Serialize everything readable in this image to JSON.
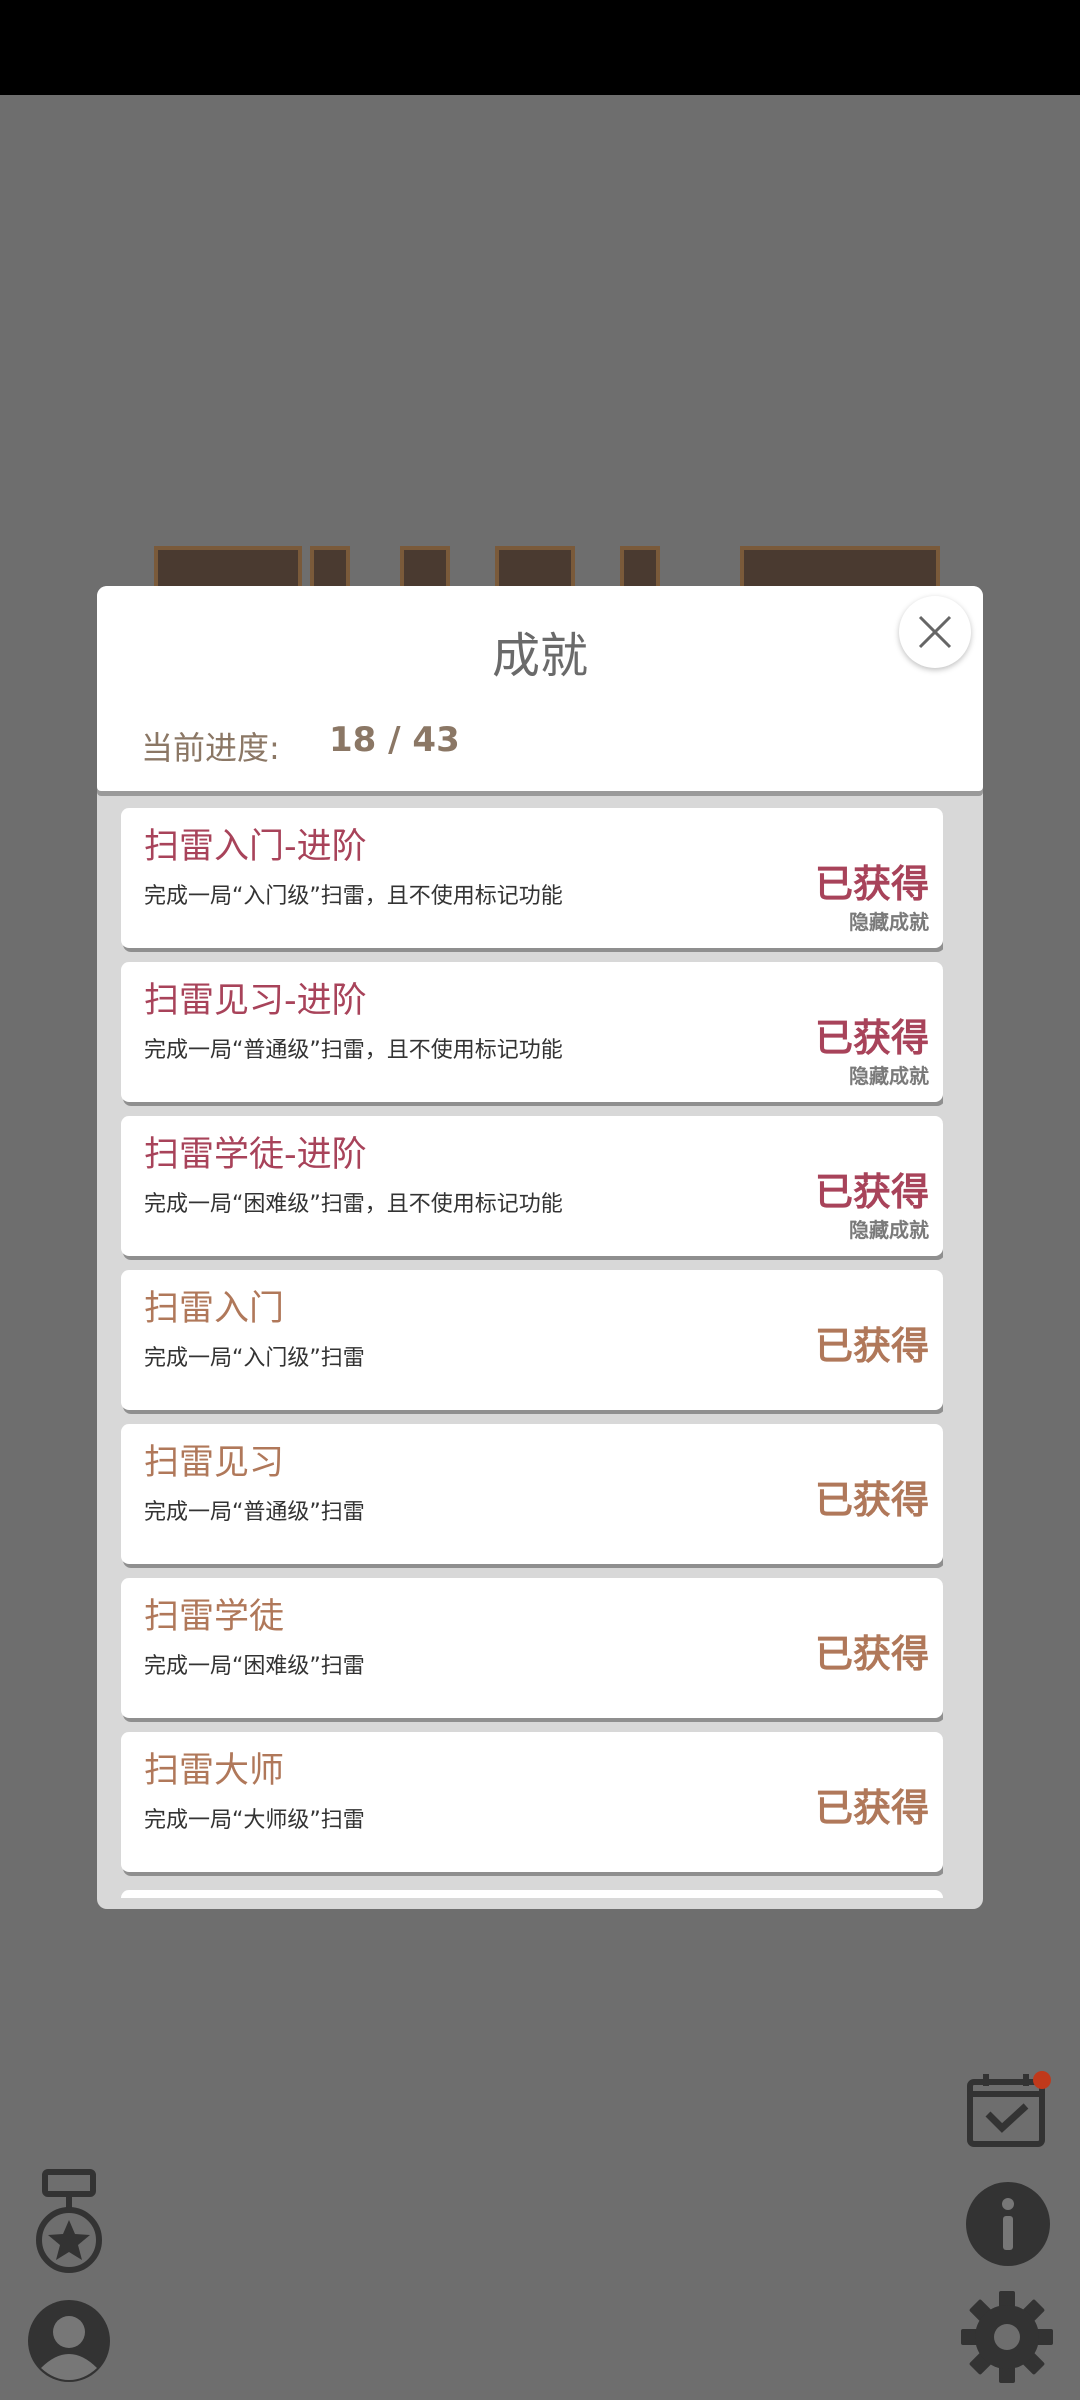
{
  "modal": {
    "title": "成就",
    "progress_label": "当前进度:",
    "progress_value": "18 / 43"
  },
  "achievements": [
    {
      "title": "扫雷入门-进阶",
      "desc": "完成一局“入门级”扫雷，且不使用标记功能",
      "status": "已获得",
      "hidden_label": "隐藏成就"
    },
    {
      "title": "扫雷见习-进阶",
      "desc": "完成一局“普通级”扫雷，且不使用标记功能",
      "status": "已获得",
      "hidden_label": "隐藏成就"
    },
    {
      "title": "扫雷学徒-进阶",
      "desc": "完成一局“困难级”扫雷，且不使用标记功能",
      "status": "已获得",
      "hidden_label": "隐藏成就"
    },
    {
      "title": "扫雷入门",
      "desc": "完成一局“入门级”扫雷",
      "status": "已获得"
    },
    {
      "title": "扫雷见习",
      "desc": "完成一局“普通级”扫雷",
      "status": "已获得"
    },
    {
      "title": "扫雷学徒",
      "desc": "完成一局“困难级”扫雷",
      "status": "已获得"
    },
    {
      "title": "扫雷大师",
      "desc": "完成一局“大师级”扫雷",
      "status": "已获得"
    }
  ],
  "icons": {
    "close": "close-icon",
    "achievement": "medal-icon",
    "profile": "user-icon",
    "daily": "calendar-check-icon",
    "info": "info-icon",
    "settings": "gear-icon"
  },
  "colors": {
    "hidden_accent": "#a8435a",
    "normal_accent": "#b0785a",
    "notification_dot": "#c0391b"
  }
}
